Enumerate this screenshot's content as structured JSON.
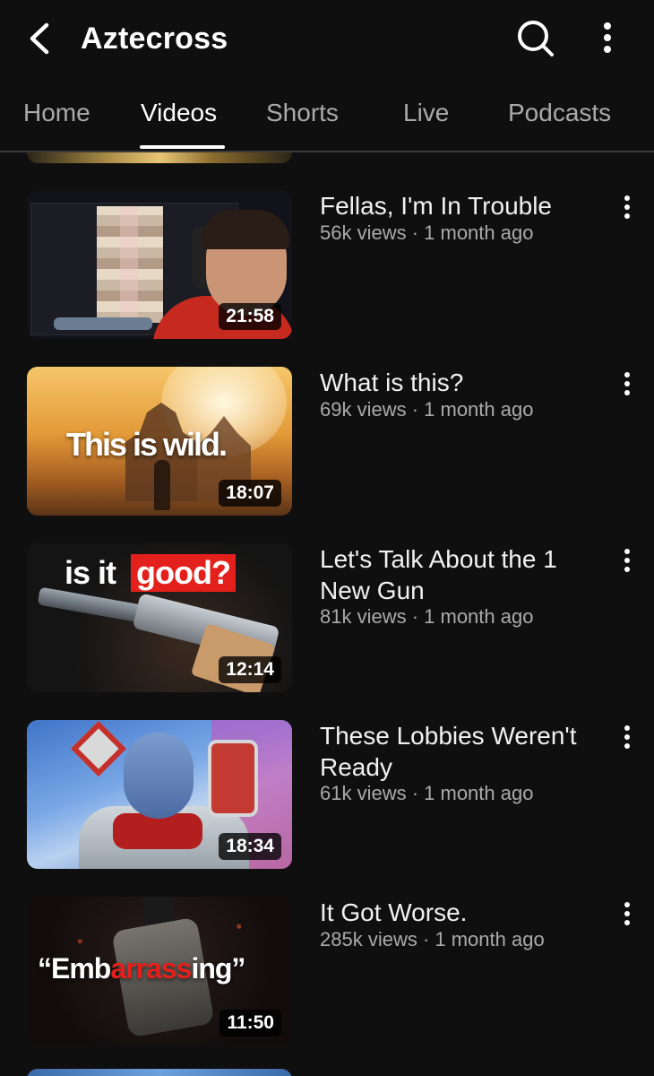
{
  "header": {
    "channel_title": "Aztecross",
    "icons": {
      "back": "chevron-left-icon",
      "search": "search-icon",
      "more": "more-vertical-icon"
    }
  },
  "tabs": [
    {
      "label": "Home",
      "active": false
    },
    {
      "label": "Videos",
      "active": true
    },
    {
      "label": "Shorts",
      "active": false
    },
    {
      "label": "Live",
      "active": false
    },
    {
      "label": "Podcasts",
      "active": false
    }
  ],
  "videos": [
    {
      "title": "Fellas, I'm In Trouble",
      "meta": "56k views · 1 month ago",
      "duration": "21:58"
    },
    {
      "title": "What is this?",
      "meta": "69k views · 1 month ago",
      "duration": "18:07",
      "thumb_text": "This is wild."
    },
    {
      "title": "Let's Talk About the 1 New Gun",
      "meta": "81k views · 1 month ago",
      "duration": "12:14",
      "thumb_text_1": "is it",
      "thumb_text_2": "good?"
    },
    {
      "title": "These Lobbies Weren't Ready",
      "meta": "61k views · 1 month ago",
      "duration": "18:34"
    },
    {
      "title": "It Got Worse.",
      "meta": "285k views · 1 month ago",
      "duration": "11:50",
      "thumb_text_1": "“Emb",
      "thumb_text_2": "arrass",
      "thumb_text_3": "ing”"
    }
  ],
  "colors": {
    "background": "#0f0f0f",
    "text_primary": "#f1f1f1",
    "text_secondary": "#aaaaaa",
    "accent_red": "#e3201b"
  }
}
